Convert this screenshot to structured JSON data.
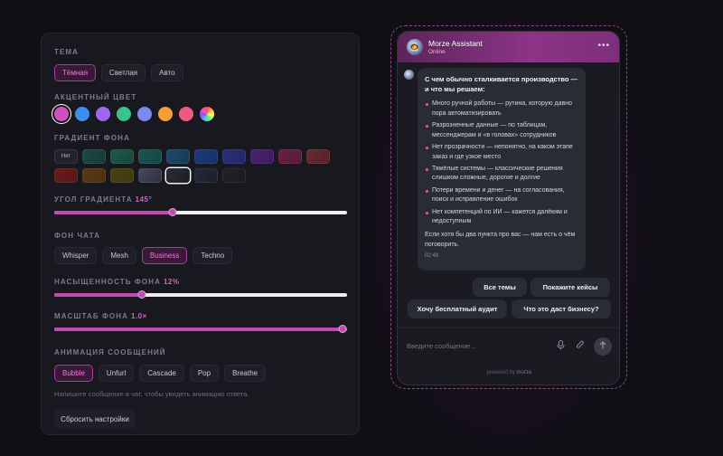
{
  "settings": {
    "theme": {
      "label": "ТЕМА",
      "options": [
        "Тёмная",
        "Светлая",
        "Авто"
      ],
      "selected": "Тёмная"
    },
    "accent": {
      "label": "АКЦЕНТНЫЙ ЦВЕТ",
      "colors": [
        "#d34fc0",
        "#3b8ff0",
        "#a066f0",
        "#35c48a",
        "#7a8af5",
        "#f5a030",
        "#f05a80",
        "rainbow"
      ],
      "selected": "#d34fc0"
    },
    "gradient": {
      "label": "ГРАДИЕНТ ФОНА",
      "none_label": "Нет"
    },
    "angle": {
      "label": "УГОЛ ГРАДИЕНТА",
      "value": "145°",
      "fraction": 0.403
    },
    "chat_bg": {
      "label": "ФОН ЧАТА",
      "options": [
        "Whisper",
        "Mesh",
        "Business",
        "Techno"
      ],
      "selected": "Business"
    },
    "saturation": {
      "label": "НАСЫЩЕННОСТЬ ФОНА",
      "value": "12%",
      "fraction": 0.3
    },
    "scale": {
      "label": "МАСШТАБ ФОНА",
      "value": "1.0×",
      "fraction": 1.0
    },
    "animation": {
      "label": "АНИМАЦИЯ СООБЩЕНИЙ",
      "options": [
        "Bubble",
        "Unfurl",
        "Cascade",
        "Pop",
        "Breathe"
      ],
      "selected": "Bubble"
    },
    "hint": "Напишите сообщение в чат, чтобы увидеть анимацию ответа.",
    "reset_label": "Сбросить настройки"
  },
  "chat": {
    "name": "Morze Assistant",
    "status": "Online",
    "message": {
      "title": "С чем обычно сталкивается производство — и что мы решаем:",
      "items": [
        "Много ручной работы — рутина, которую давно пора автоматизировать",
        "Разрозненные данные — по таблицам, мессенджерам и «в головах» сотрудников",
        "Нет прозрачности — непонятно, на каком этапе заказ и где узкое место",
        "Тяжёлые системы — классические решения слишком сложные, дорогие и долгие",
        "Потери времени и денег — на согласования, поиск и исправление ошибок",
        "Нет компетенций по ИИ — кажется далёким и недоступным"
      ],
      "outro": "Если хотя бы два пункта про вас — нам есть о чём поговорить.",
      "time": "02:48"
    },
    "quick_replies": [
      "Все темы",
      "Покажите кейсы",
      "Хочу бесплатный аудит",
      "Что это даст бизнесу?"
    ],
    "input_placeholder": "Введите сообщение...",
    "powered_prefix": "powered by",
    "powered_brand": "morze"
  }
}
